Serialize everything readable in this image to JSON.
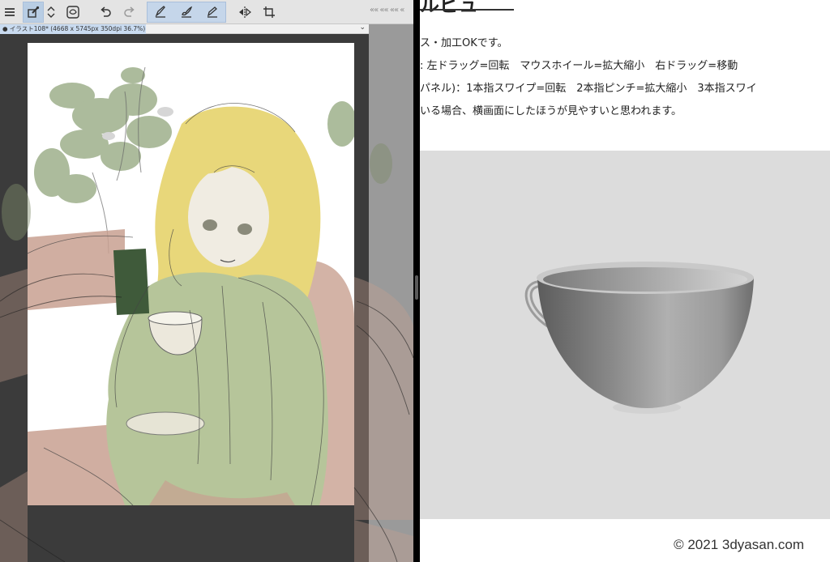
{
  "app": {
    "document_tab": "● イラスト108* (4668 x 5745px 350dpi 36.7%)",
    "panel_collapse": "«« «« «« «",
    "tab_menu": "⌄",
    "toolbar": [
      {
        "name": "menu",
        "icon": "menu-icon"
      },
      {
        "name": "eyedropper",
        "icon": "eyedropper-icon"
      },
      {
        "name": "stepper",
        "icon": "updown-icon"
      },
      {
        "name": "layer",
        "icon": "layer-icon"
      },
      {
        "name": "undo",
        "icon": "undo-icon"
      },
      {
        "name": "redo",
        "icon": "redo-icon"
      },
      {
        "name": "pen",
        "icon": "pen-icon"
      },
      {
        "name": "brush",
        "icon": "brush-icon"
      },
      {
        "name": "pencil",
        "icon": "pencil-icon"
      },
      {
        "name": "flip",
        "icon": "flip-icon"
      },
      {
        "name": "transform",
        "icon": "transform-icon"
      }
    ]
  },
  "web": {
    "heading": "ルビュ",
    "lines": [
      "ス・加工OKです。",
      ": 左ドラッグ=回転　マウスホイール=拡大縮小　右ドラッグ=移動",
      "パネル)：1本指スワイプ=回転　2本指ピンチ=拡大縮小　3本指スワイ",
      "いる場合、横画面にしたほうが見やすいと思われます。"
    ],
    "copyright": "© 2021 3dyasan.com"
  },
  "colors": {
    "toolbar_bg": "#e4e4e4",
    "active_tool": "#c5d6ea",
    "workspace": "#3b3b3b",
    "viewer_bg": "#dcdcdc",
    "hair": "#e8d77a",
    "dress": "#b6c59a",
    "leaves": "#a8b897",
    "chair": "#c8a090"
  }
}
